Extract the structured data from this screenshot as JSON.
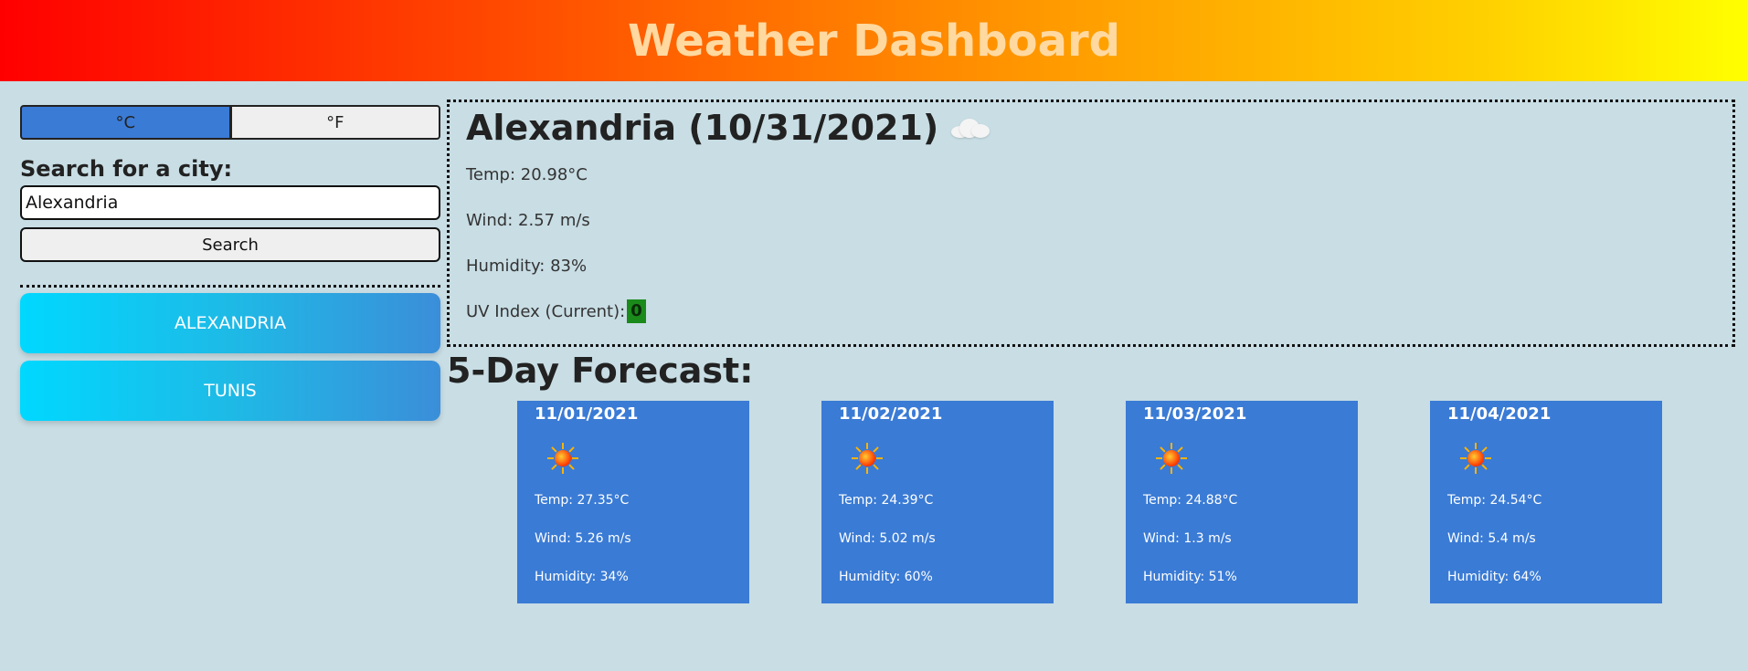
{
  "header": {
    "title": "Weather Dashboard"
  },
  "sidebar": {
    "unit_celsius": "°C",
    "unit_fahrenheit": "°F",
    "search_label": "Search for a city:",
    "search_value": "Alexandria",
    "search_button": "Search",
    "history": [
      "ALEXANDRIA",
      "TUNIS"
    ]
  },
  "current": {
    "title": "Alexandria (10/31/2021)",
    "icon": "cloud-icon",
    "temp": "Temp: 20.98°C",
    "wind": "Wind: 2.57 m/s",
    "humidity": "Humidity: 83%",
    "uv_label": "UV Index (Current):",
    "uv_value": "0",
    "uv_color": "#1a8a1a"
  },
  "forecast": {
    "title": "5-Day Forecast:",
    "days": [
      {
        "date": "11/01/2021",
        "icon": "sun-icon",
        "temp": "Temp: 27.35°C",
        "wind": "Wind: 5.26 m/s",
        "humidity": "Humidity: 34%"
      },
      {
        "date": "11/02/2021",
        "icon": "sun-icon",
        "temp": "Temp: 24.39°C",
        "wind": "Wind: 5.02 m/s",
        "humidity": "Humidity: 60%"
      },
      {
        "date": "11/03/2021",
        "icon": "sun-icon",
        "temp": "Temp: 24.88°C",
        "wind": "Wind: 1.3 m/s",
        "humidity": "Humidity: 51%"
      },
      {
        "date": "11/04/2021",
        "icon": "sun-icon",
        "temp": "Temp: 24.54°C",
        "wind": "Wind: 5.4 m/s",
        "humidity": "Humidity: 64%"
      }
    ]
  },
  "colors": {
    "accent": "#3a7bd5",
    "background": "#c8dde4",
    "header_gradient_start": "#ff0000",
    "header_gradient_end": "#ffff00"
  }
}
